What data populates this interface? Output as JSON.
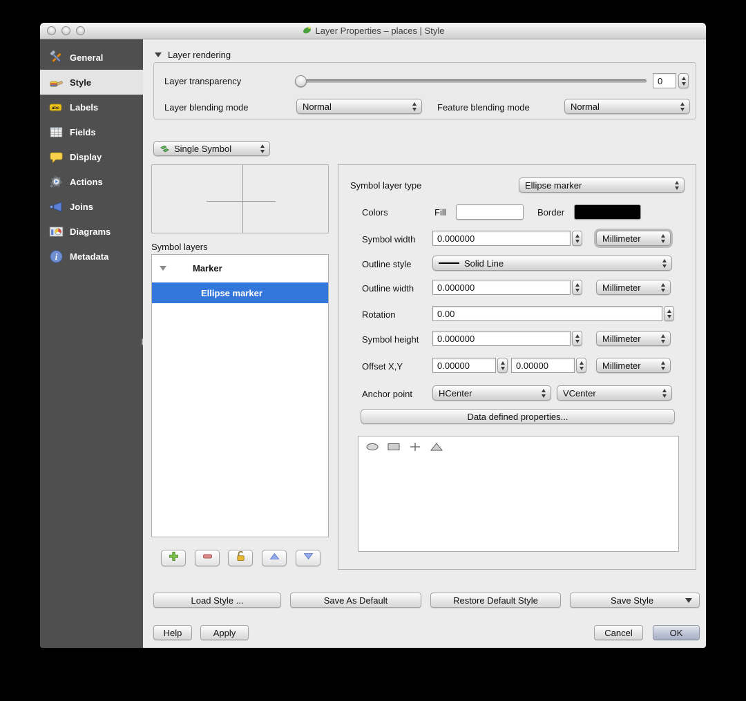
{
  "window": {
    "title": "Layer Properties – places | Style",
    "app_icon": "qgis-icon"
  },
  "sidebar": {
    "background": "#4f4f4f",
    "items": [
      {
        "label": "General",
        "icon": "tools-icon",
        "selected": false
      },
      {
        "label": "Style",
        "icon": "paintbrush-icon",
        "selected": true
      },
      {
        "label": "Labels",
        "icon": "abc-tag-icon",
        "selected": false
      },
      {
        "label": "Fields",
        "icon": "table-icon",
        "selected": false
      },
      {
        "label": "Display",
        "icon": "speech-bubble-icon",
        "selected": false
      },
      {
        "label": "Actions",
        "icon": "gear-icon",
        "selected": false
      },
      {
        "label": "Joins",
        "icon": "join-arrow-icon",
        "selected": false
      },
      {
        "label": "Diagrams",
        "icon": "chart-icon",
        "selected": false
      },
      {
        "label": "Metadata",
        "icon": "info-icon",
        "selected": false
      }
    ]
  },
  "layer_rendering": {
    "header": "Layer rendering",
    "transparency_label": "Layer transparency",
    "transparency_value": "0",
    "blending_label": "Layer blending mode",
    "blending_value": "Normal",
    "feature_blending_label": "Feature blending mode",
    "feature_blending_value": "Normal"
  },
  "symbol": {
    "renderer_value": "Single Symbol",
    "symbol_layers_label": "Symbol layers",
    "tree": {
      "group_label": "Marker",
      "selected_layer": "Ellipse marker"
    },
    "selection_color": "#3377dd"
  },
  "properties": {
    "type_label": "Symbol layer type",
    "type_value": "Ellipse marker",
    "colors_label": "Colors",
    "fill_label": "Fill",
    "fill_color": "#ffffff",
    "border_label": "Border",
    "border_color": "#000000",
    "symbol_width": {
      "label": "Symbol width",
      "value": "0.000000",
      "unit": "Millimeter"
    },
    "outline_style": {
      "label": "Outline style",
      "value": "Solid Line"
    },
    "outline_width": {
      "label": "Outline width",
      "value": "0.000000",
      "unit": "Millimeter"
    },
    "rotation": {
      "label": "Rotation",
      "value": "0.00"
    },
    "symbol_height": {
      "label": "Symbol height",
      "value": "0.000000",
      "unit": "Millimeter"
    },
    "offset": {
      "label": "Offset X,Y",
      "x_value": "0.00000",
      "y_value": "0.00000",
      "unit": "Millimeter"
    },
    "anchor": {
      "label": "Anchor point",
      "h_value": "HCenter",
      "v_value": "VCenter"
    },
    "data_defined_button": "Data defined properties...",
    "shapes": [
      "ellipse",
      "rectangle",
      "cross",
      "triangle"
    ]
  },
  "style_actions": {
    "load": "Load Style ...",
    "save_as_default": "Save As Default",
    "restore_default": "Restore Default Style",
    "save_style": "Save Style"
  },
  "dialog_actions": {
    "help": "Help",
    "apply": "Apply",
    "cancel": "Cancel",
    "ok": "OK"
  }
}
